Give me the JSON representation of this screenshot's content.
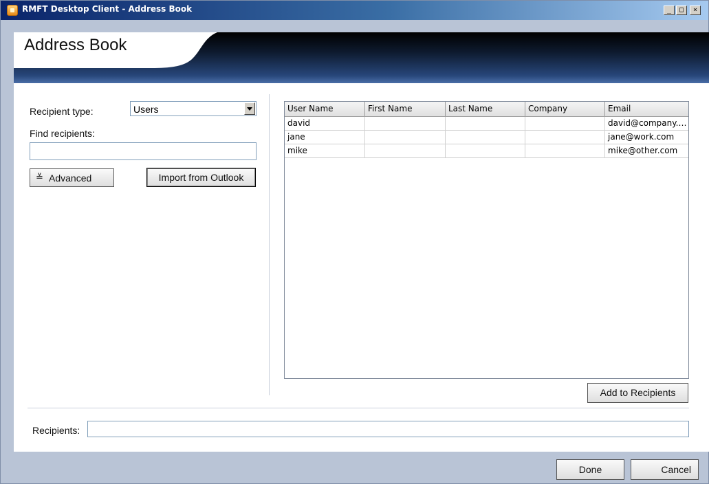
{
  "window": {
    "title": "RMFT Desktop Client - Address Book",
    "controls": {
      "minimize": "_",
      "maximize": "□",
      "close": "×"
    }
  },
  "header": {
    "title": "Address Book"
  },
  "search": {
    "recipient_type_label": "Recipient type:",
    "recipient_type_value": "Users",
    "find_label": "Find recipients:",
    "find_value": "",
    "advanced_label": "Advanced",
    "advanced_icon": "double-chevron-down-icon",
    "import_label": "Import from Outlook"
  },
  "table": {
    "columns": [
      "User Name",
      "First Name",
      "Last Name",
      "Company",
      "Email"
    ],
    "rows": [
      [
        "david",
        "",
        "",
        "",
        "david@company.com"
      ],
      [
        "jane",
        "",
        "",
        "",
        "jane@work.com"
      ],
      [
        "mike",
        "",
        "",
        "",
        "mike@other.com"
      ]
    ]
  },
  "actions": {
    "add_to_recipients": "Add to Recipients"
  },
  "recipients": {
    "label": "Recipients:",
    "value": ""
  },
  "footer": {
    "done": "Done",
    "cancel": "Cancel"
  }
}
